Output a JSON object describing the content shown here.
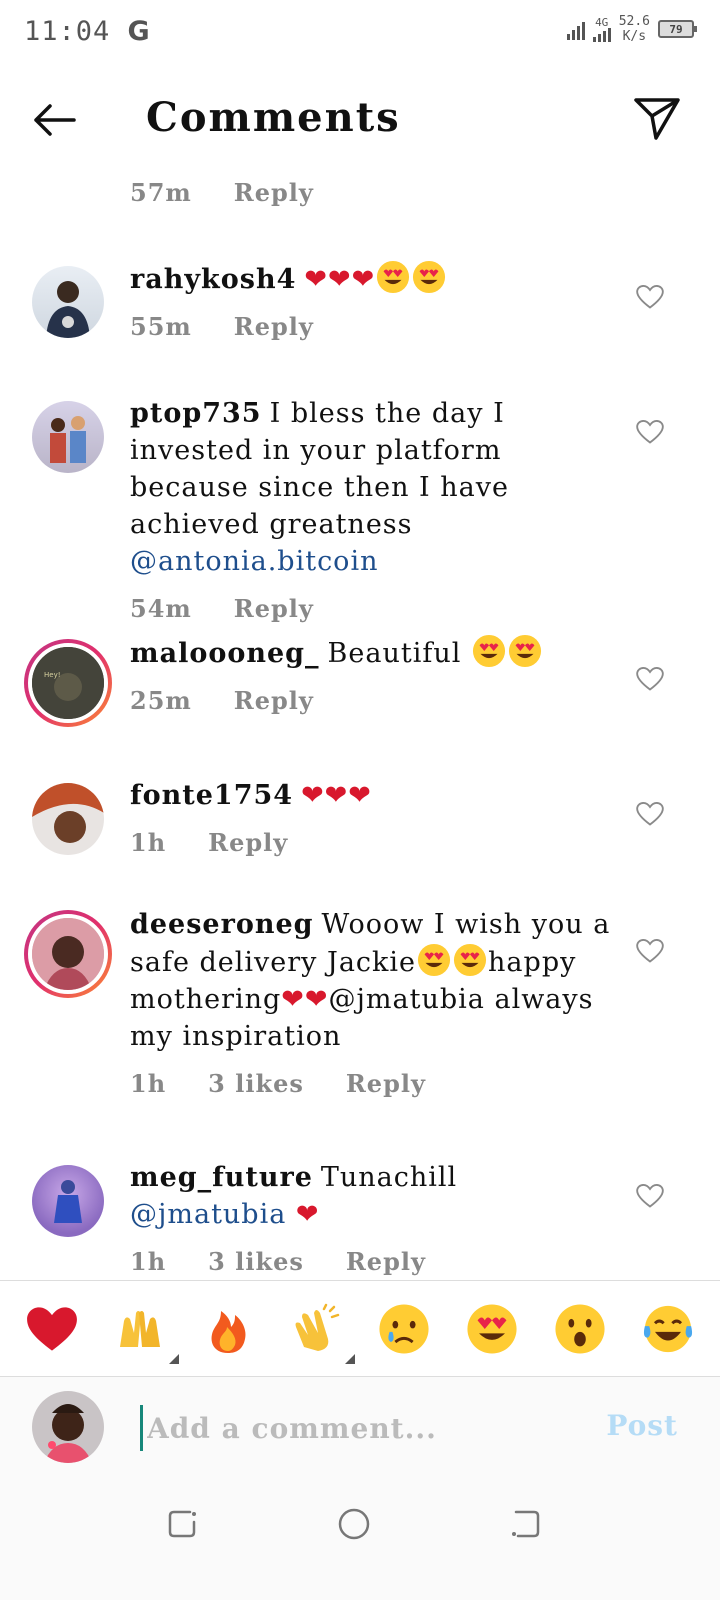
{
  "status": {
    "time": "11:04",
    "carrier_icon": "G",
    "network": "4G",
    "speed_value": "52.6",
    "speed_unit": "K/s",
    "battery": "79"
  },
  "header": {
    "title": "Comments",
    "back_icon": "arrow-left-icon",
    "share_icon": "paper-plane-icon"
  },
  "prev_comment": {
    "time": "57m",
    "reply_label": "Reply"
  },
  "comments": [
    {
      "username": "rahykosh4",
      "time": "55m",
      "reply_label": "Reply"
    },
    {
      "username": "ptop735",
      "text": "I bless the day I invested in your platform because since then I have achieved greatness",
      "mention": "@antonia.bitcoin",
      "time": "54m",
      "reply_label": "Reply"
    },
    {
      "username": "maloooneg_",
      "text": "Beautiful",
      "time": "25m",
      "reply_label": "Reply"
    },
    {
      "username": "fonte1754",
      "time": "1h",
      "reply_label": "Reply"
    },
    {
      "username": "deeseroneg",
      "text_a": "Wooow I wish you a safe delivery Jackie",
      "text_b": "happy mothering",
      "mention": "@jmatubia",
      "text_c": "always my inspiration",
      "time": "1h",
      "likes": "3 likes",
      "reply_label": "Reply"
    },
    {
      "username": "meg_future",
      "text": "Tunachill",
      "mention": "@jmatubia",
      "time": "1h",
      "likes": "3 likes",
      "reply_label": "Reply"
    }
  ],
  "emoji_bar": [
    "red-heart",
    "raising-hands",
    "fire",
    "clapping-hands",
    "crying-face",
    "heart-eyes-face",
    "astonished-face",
    "tears-of-joy-face"
  ],
  "composer": {
    "placeholder": "Add a comment...",
    "post_label": "Post"
  },
  "colors": {
    "mention": "#1e4e8c",
    "heart": "#d8182d",
    "post_disabled": "#b5dcf6",
    "story_ring": "#e1306c"
  }
}
